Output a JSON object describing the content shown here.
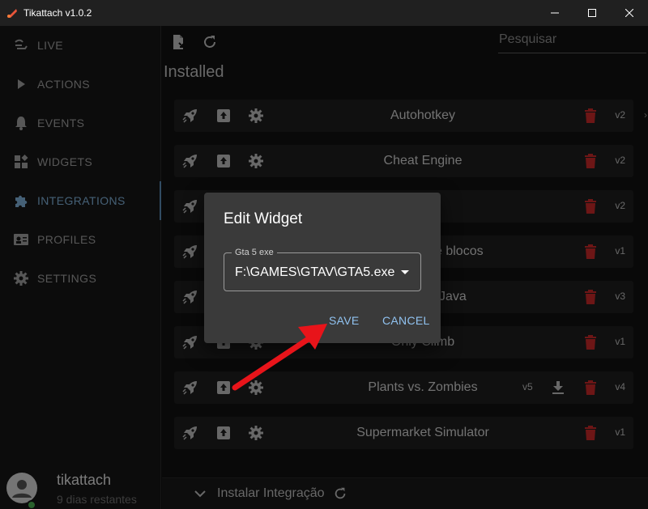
{
  "window": {
    "title": "Tikattach v1.0.2"
  },
  "sidebar": {
    "items": [
      {
        "label": "LIVE",
        "icon": "live-icon"
      },
      {
        "label": "ACTIONS",
        "icon": "play-icon"
      },
      {
        "label": "EVENTS",
        "icon": "bell-icon"
      },
      {
        "label": "WIDGETS",
        "icon": "widgets-icon"
      },
      {
        "label": "INTEGRATIONS",
        "icon": "puzzle-icon",
        "active": true
      },
      {
        "label": "PROFILES",
        "icon": "profile-card-icon"
      },
      {
        "label": "SETTINGS",
        "icon": "gear-icon"
      }
    ],
    "user": {
      "name": "tikattach",
      "subtitle": "9 dias restantes"
    }
  },
  "toolbar": {
    "search_placeholder": "Pesquisar"
  },
  "main": {
    "section_title": "Installed",
    "rows": [
      {
        "name": "Autohotkey",
        "version": "v2"
      },
      {
        "name": "Cheat Engine",
        "version": "v2"
      },
      {
        "name": "",
        "version": "v2"
      },
      {
        "name": "e blocos",
        "version": "v1"
      },
      {
        "name": "Java",
        "version": "v3"
      },
      {
        "name": "Only Climb",
        "version": "v1"
      },
      {
        "name": "Plants vs. Zombies",
        "version": "v4",
        "update_version": "v5"
      },
      {
        "name": "Supermarket Simulator",
        "version": "v1"
      }
    ],
    "footer_label": "Instalar Integração"
  },
  "dialog": {
    "title": "Edit Widget",
    "field_label": "Gta 5 exe",
    "field_value": "F:\\GAMES\\GTAV\\GTA5.exe",
    "save_label": "SAVE",
    "cancel_label": "CANCEL"
  },
  "colors": {
    "accent": "#7fb0d8",
    "delete": "#c62828",
    "annotation_arrow": "#e8141a"
  }
}
